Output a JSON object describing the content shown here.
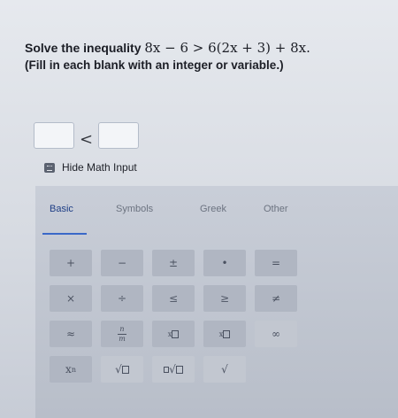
{
  "question": {
    "prefix": "Solve the inequality",
    "expression": "8x − 6 > 6(2x + 3) + 8x.",
    "instruction": "(Fill in each blank with an integer or variable.)"
  },
  "answer": {
    "relation": "<"
  },
  "toggle": {
    "label": "Hide Math Input",
    "icon": "keyboard-icon"
  },
  "tabs": [
    "Basic",
    "Symbols",
    "Greek",
    "Other"
  ],
  "active_tab": "Basic",
  "keypad": {
    "row1": [
      "+",
      "−",
      "±",
      "•",
      "="
    ],
    "row2": [
      "×",
      "÷",
      "≤",
      "≥",
      "≠"
    ],
    "row3": {
      "approx": "≈",
      "frac_top": "n",
      "frac_bottom": "m",
      "sub_x": "x",
      "sup_x": "x",
      "infinity": "∞"
    },
    "row4": {
      "power_base": "x",
      "power_exp": "n",
      "sqrt": "√",
      "nthroot": "√",
      "check": "√"
    }
  },
  "colors": {
    "accent": "#3a68c8",
    "active_tab_text": "#1f3f86"
  }
}
